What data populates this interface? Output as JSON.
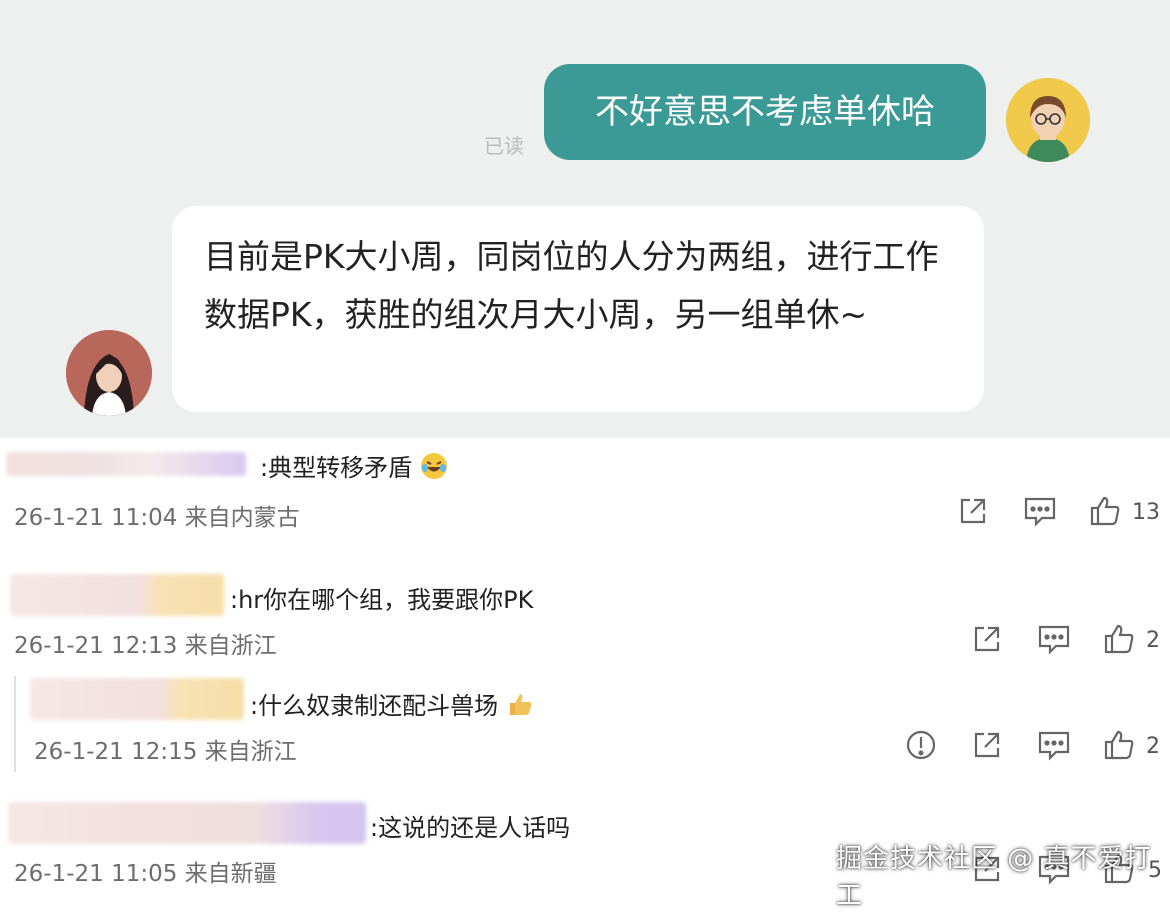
{
  "chat": {
    "outgoing_message": "不好意思不考虑单休哈",
    "read_status": "已读",
    "incoming_message": "目前是PK大小周，同岗位的人分为两组，进行工作数据PK，获胜的组次月大小周，另一组单休~"
  },
  "comments": [
    {
      "text": ":典型转移矛盾",
      "date": "26-1-21 11:04",
      "location": "来自内蒙古",
      "likes": "13",
      "emoji": "laughing-crying"
    },
    {
      "text": ":hr你在哪个组，我要跟你PK",
      "date": "26-1-21 12:13",
      "location": "来自浙江",
      "likes": "2"
    },
    {
      "text": ":什么奴隶制还配斗兽场",
      "date": "26-1-21 12:15",
      "location": "来自浙江",
      "likes": "2",
      "emoji": "thumbs-up"
    },
    {
      "text": ":这说的还是人话吗",
      "date": "26-1-21 11:05",
      "location": "来自新疆",
      "likes": "5"
    }
  ],
  "watermark": "掘金技术社区 @ 真不爱打工",
  "colors": {
    "outgoing_bubble": "#3c9a96",
    "chat_background": "#eeefef",
    "meta_text": "#6d6d6d"
  },
  "icons": [
    "share-icon",
    "comment-icon",
    "thumbs-up-icon",
    "report-icon"
  ]
}
